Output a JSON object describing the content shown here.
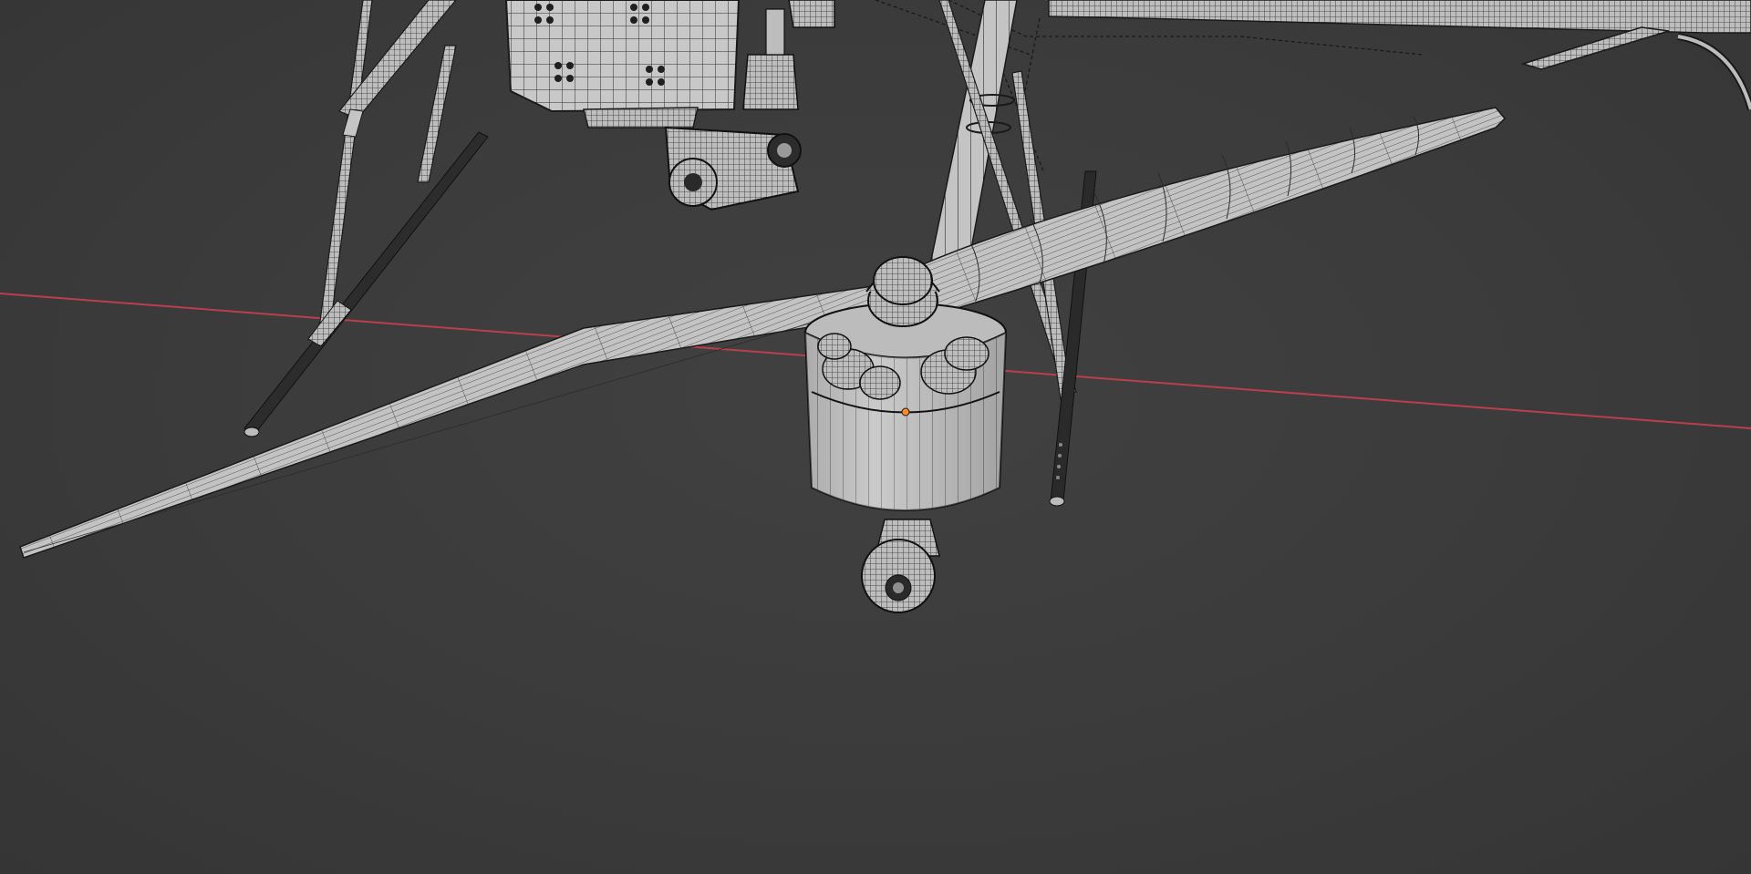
{
  "viewport": {
    "name": "3D Viewport",
    "shading_mode": "solid-wireframe",
    "background_color": "#3d3d3d",
    "x_axis_color": "#b8404c",
    "mesh_fill_color": "#c9c9c9",
    "mesh_wire_color": "#1e1e1e",
    "origin_color": "#ff8a1f"
  },
  "scene": {
    "objects": [
      {
        "name": "propeller-blade",
        "icon": "mesh-icon"
      },
      {
        "name": "propeller-hub",
        "icon": "mesh-icon"
      },
      {
        "name": "motor-housing",
        "icon": "mesh-icon"
      },
      {
        "name": "motor-mount",
        "icon": "mesh-icon"
      },
      {
        "name": "drone-arm",
        "icon": "mesh-icon"
      },
      {
        "name": "landing-gear",
        "icon": "mesh-icon"
      },
      {
        "name": "gimbal-camera",
        "icon": "mesh-icon"
      },
      {
        "name": "electronics-box",
        "icon": "mesh-icon"
      },
      {
        "name": "antenna-rod",
        "icon": "mesh-icon"
      }
    ]
  }
}
